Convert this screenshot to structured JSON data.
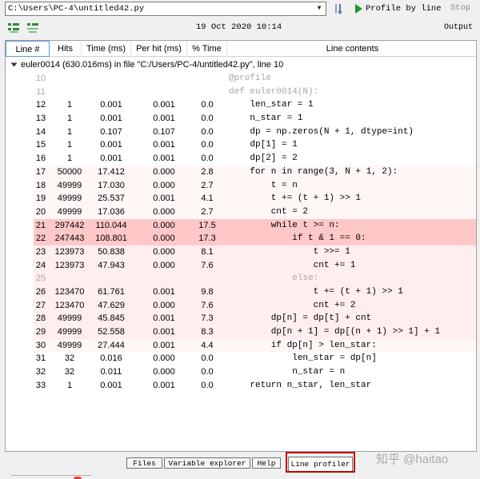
{
  "toolbar": {
    "file_path": "C:\\Users\\PC-4\\untitled42.py",
    "run_label": "Profile by line",
    "stop_label": "Stop",
    "datetime": "19 Oct 2020 10:14",
    "output_label": "Output"
  },
  "icons": [
    "dropdown-arrow-icon",
    "browse-folder-icon",
    "play-icon",
    "expand-all-icon",
    "collapse-all-icon",
    "collapse-triangle-icon"
  ],
  "colors": {
    "hot": "#ffc8c8",
    "warm": "#ffe3e3",
    "mild": "#ffeeee",
    "faint": "#fff6f6",
    "run_green": "#1a9a2a",
    "highlight_red": "#c00000"
  },
  "columns": [
    "Line #",
    "Hits",
    "Time (ms)",
    "Per hit (ms)",
    "% Time",
    "Line contents"
  ],
  "function_header": "euler0014 (630.016ms) in file \"C:/Users/PC-4/untitled42.py\", line 10",
  "rows": [
    {
      "line": "10",
      "hits": "",
      "time": "",
      "per_hit": "",
      "pct": "",
      "code": "@profile",
      "heat": "none",
      "grey": true
    },
    {
      "line": "11",
      "hits": "",
      "time": "",
      "per_hit": "",
      "pct": "",
      "code": "def euler0014(N):",
      "heat": "none",
      "grey": true
    },
    {
      "line": "12",
      "hits": "1",
      "time": "0.001",
      "per_hit": "0.001",
      "pct": "0.0",
      "code": "    len_star = 1",
      "heat": "none",
      "grey": false
    },
    {
      "line": "13",
      "hits": "1",
      "time": "0.001",
      "per_hit": "0.001",
      "pct": "0.0",
      "code": "    n_star = 1",
      "heat": "none",
      "grey": false
    },
    {
      "line": "14",
      "hits": "1",
      "time": "0.107",
      "per_hit": "0.107",
      "pct": "0.0",
      "code": "    dp = np.zeros(N + 1, dtype=int)",
      "heat": "none",
      "grey": false
    },
    {
      "line": "15",
      "hits": "1",
      "time": "0.001",
      "per_hit": "0.001",
      "pct": "0.0",
      "code": "    dp[1] = 1",
      "heat": "none",
      "grey": false
    },
    {
      "line": "16",
      "hits": "1",
      "time": "0.001",
      "per_hit": "0.001",
      "pct": "0.0",
      "code": "    dp[2] = 2",
      "heat": "none",
      "grey": false
    },
    {
      "line": "17",
      "hits": "50000",
      "time": "17.412",
      "per_hit": "0.000",
      "pct": "2.8",
      "code": "    for n in range(3, N + 1, 2):",
      "heat": "faint",
      "grey": false
    },
    {
      "line": "18",
      "hits": "49999",
      "time": "17.030",
      "per_hit": "0.000",
      "pct": "2.7",
      "code": "        t = n",
      "heat": "faint",
      "grey": false
    },
    {
      "line": "19",
      "hits": "49999",
      "time": "25.537",
      "per_hit": "0.001",
      "pct": "4.1",
      "code": "        t += (t + 1) >> 1",
      "heat": "faint",
      "grey": false
    },
    {
      "line": "20",
      "hits": "49999",
      "time": "17.036",
      "per_hit": "0.000",
      "pct": "2.7",
      "code": "        cnt = 2",
      "heat": "faint",
      "grey": false
    },
    {
      "line": "21",
      "hits": "297442",
      "time": "110.044",
      "per_hit": "0.000",
      "pct": "17.5",
      "code": "        while t >= n:",
      "heat": "hot",
      "grey": false
    },
    {
      "line": "22",
      "hits": "247443",
      "time": "108.801",
      "per_hit": "0.000",
      "pct": "17.3",
      "code": "            if t & 1 == 0:",
      "heat": "hot",
      "grey": false
    },
    {
      "line": "23",
      "hits": "123973",
      "time": "50.838",
      "per_hit": "0.000",
      "pct": "8.1",
      "code": "                t >>= 1",
      "heat": "mild",
      "grey": false
    },
    {
      "line": "24",
      "hits": "123973",
      "time": "47.943",
      "per_hit": "0.000",
      "pct": "7.6",
      "code": "                cnt += 1",
      "heat": "mild",
      "grey": false
    },
    {
      "line": "25",
      "hits": "",
      "time": "",
      "per_hit": "",
      "pct": "",
      "code": "            else:",
      "heat": "mild",
      "grey": true
    },
    {
      "line": "26",
      "hits": "123470",
      "time": "61.761",
      "per_hit": "0.001",
      "pct": "9.8",
      "code": "                t += (t + 1) >> 1",
      "heat": "mild",
      "grey": false
    },
    {
      "line": "27",
      "hits": "123470",
      "time": "47.629",
      "per_hit": "0.000",
      "pct": "7.6",
      "code": "                cnt += 2",
      "heat": "mild",
      "grey": false
    },
    {
      "line": "28",
      "hits": "49999",
      "time": "45.845",
      "per_hit": "0.001",
      "pct": "7.3",
      "code": "        dp[n] = dp[t] + cnt",
      "heat": "mild",
      "grey": false
    },
    {
      "line": "29",
      "hits": "49999",
      "time": "52.558",
      "per_hit": "0.001",
      "pct": "8.3",
      "code": "        dp[n + 1] = dp[(n + 1) >> 1] + 1",
      "heat": "mild",
      "grey": false
    },
    {
      "line": "30",
      "hits": "49999",
      "time": "27.444",
      "per_hit": "0.001",
      "pct": "4.4",
      "code": "        if dp[n] > len_star:",
      "heat": "faint",
      "grey": false
    },
    {
      "line": "31",
      "hits": "32",
      "time": "0.016",
      "per_hit": "0.000",
      "pct": "0.0",
      "code": "            len_star = dp[n]",
      "heat": "none",
      "grey": false
    },
    {
      "line": "32",
      "hits": "32",
      "time": "0.011",
      "per_hit": "0.000",
      "pct": "0.0",
      "code": "            n_star = n",
      "heat": "none",
      "grey": false
    },
    {
      "line": "33",
      "hits": "1",
      "time": "0.001",
      "per_hit": "0.001",
      "pct": "0.0",
      "code": "    return n_star, len_star",
      "heat": "none",
      "grey": false
    }
  ],
  "tabs": [
    "Files",
    "Variable explorer",
    "Help",
    "Line profiler"
  ],
  "selected_tab": "Line profiler",
  "watermark": "知乎 @haitao"
}
